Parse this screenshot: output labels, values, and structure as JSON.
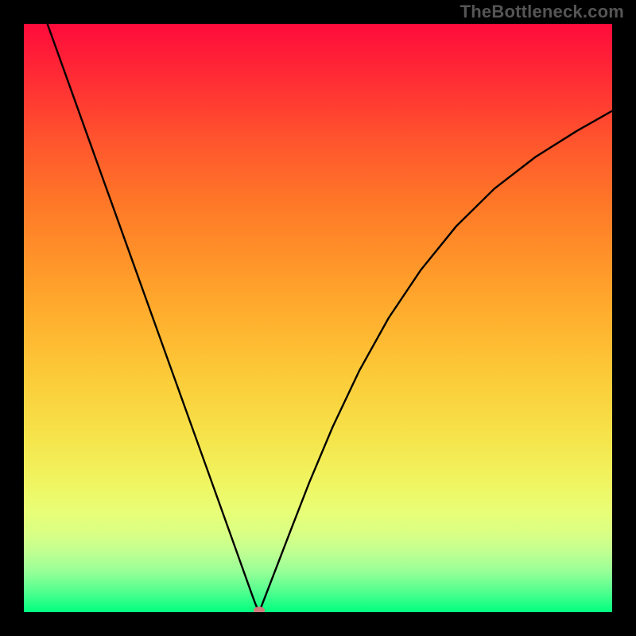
{
  "watermark": "TheBottleneck.com",
  "chart_data": {
    "type": "line",
    "title": "",
    "xlabel": "",
    "ylabel": "",
    "xlim": [
      0,
      100
    ],
    "ylim": [
      0,
      100
    ],
    "background": {
      "type": "vertical-gradient",
      "stops": [
        {
          "offset": 0.0,
          "color": "#ff0b3b"
        },
        {
          "offset": 0.1,
          "color": "#ff2f34"
        },
        {
          "offset": 0.2,
          "color": "#ff552d"
        },
        {
          "offset": 0.3,
          "color": "#ff7628"
        },
        {
          "offset": 0.4,
          "color": "#ff9329"
        },
        {
          "offset": 0.5,
          "color": "#ffb02e"
        },
        {
          "offset": 0.6,
          "color": "#fccb39"
        },
        {
          "offset": 0.7,
          "color": "#f6e34a"
        },
        {
          "offset": 0.78,
          "color": "#f0f561"
        },
        {
          "offset": 0.83,
          "color": "#e8fe76"
        },
        {
          "offset": 0.87,
          "color": "#d7ff86"
        },
        {
          "offset": 0.9,
          "color": "#beff92"
        },
        {
          "offset": 0.93,
          "color": "#98ff97"
        },
        {
          "offset": 0.96,
          "color": "#5dff91"
        },
        {
          "offset": 1.0,
          "color": "#00ff7f"
        }
      ]
    },
    "series": [
      {
        "name": "bottleneck-curve",
        "color": "#000000",
        "stroke_width": 2.4,
        "x": [
          4.0,
          7.3,
          10.6,
          13.9,
          17.2,
          20.5,
          23.8,
          27.1,
          30.4,
          33.7,
          36.2,
          37.7,
          38.7,
          39.4,
          40.0,
          41.0,
          42.7,
          45.2,
          48.5,
          52.5,
          57.0,
          62.0,
          67.5,
          73.5,
          80.0,
          87.0,
          94.0,
          100.0
        ],
        "y": [
          100.0,
          90.8,
          81.6,
          72.4,
          63.2,
          54.0,
          44.8,
          35.6,
          26.4,
          17.2,
          10.2,
          6.0,
          3.2,
          1.3,
          0.0,
          2.6,
          7.0,
          13.5,
          22.0,
          31.5,
          41.0,
          50.0,
          58.2,
          65.6,
          72.0,
          77.4,
          81.8,
          85.2
        ]
      }
    ],
    "marker": {
      "name": "minimum-point",
      "x": 40.0,
      "y": 0.0,
      "color": "#cf7b7b"
    }
  }
}
